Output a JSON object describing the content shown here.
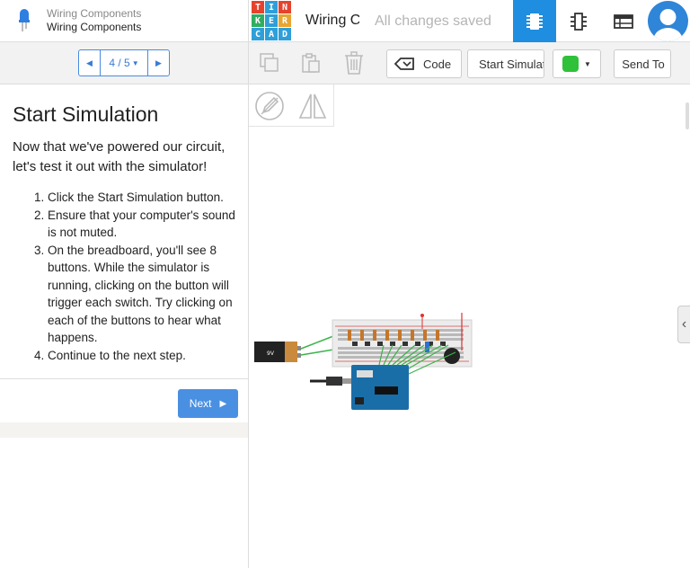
{
  "lesson": {
    "parent_title": "Wiring Components",
    "title": "Wiring Components"
  },
  "pager": {
    "position": "4 / 5",
    "prev_icon": "chevron-left-icon",
    "next_icon": "chevron-right-icon"
  },
  "step": {
    "heading": "Start Simulation",
    "intro": "Now that we've powered our circuit, let's test it out with the simulator!",
    "items": [
      "Click the Start Simulation button.",
      "Ensure that your computer's sound is not muted.",
      "On the breadboard, you'll see 8 buttons. While the simulator is running, clicking on the button will trigger each switch. Try clicking on each of the buttons to hear what happens.",
      "Continue to the next step."
    ],
    "next_label": "Next"
  },
  "topbar": {
    "logo_letters": [
      "T",
      "I",
      "N",
      "K",
      "E",
      "R",
      "C",
      "A",
      "D"
    ],
    "project_name": "Wiring Components",
    "status": "All changes saved"
  },
  "toolbar": {
    "code_label": "Code",
    "simulation_label": "Start Simulation",
    "send_label": "Send To"
  },
  "colors": {
    "accent": "#1f8ee0",
    "button": "#4a90e2",
    "logo": [
      "#e5432e",
      "#2e9fd8",
      "#e5432e",
      "#2fae62",
      "#2e9fd8",
      "#e8a531",
      "#2e9fd8",
      "#2e9fd8",
      "#2e9fd8"
    ]
  }
}
